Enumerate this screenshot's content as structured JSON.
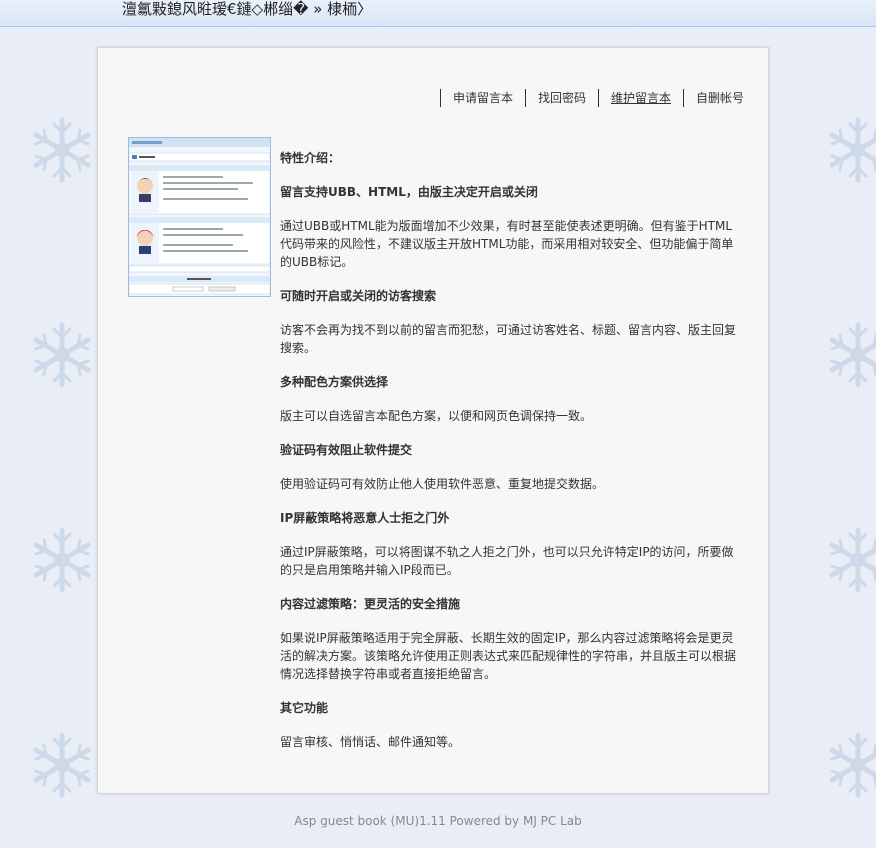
{
  "topbar": {
    "breadcrumb": "澶氱敤鎴风暀瑷€鏈◇郴缁� » 棣栭〉"
  },
  "nav": {
    "items": [
      {
        "label": "申请留言本",
        "active": false
      },
      {
        "label": "找回密码",
        "active": false
      },
      {
        "label": "维护留言本",
        "active": true
      },
      {
        "label": "自删帐号",
        "active": false
      }
    ]
  },
  "main": {
    "heading": "特性介绍：",
    "sections": [
      {
        "title": "留言支持UBB、HTML，由版主决定开启或关闭",
        "body": "通过UBB或HTML能为版面增加不少效果，有时甚至能使表述更明确。但有鉴于HTML代码带来的风险性，不建议版主开放HTML功能，而采用相对较安全、但功能偏于简单的UBB标记。"
      },
      {
        "title": "可随时开启或关闭的访客搜索",
        "body": "访客不会再为找不到以前的留言而犯愁，可通过访客姓名、标题、留言内容、版主回复搜索。"
      },
      {
        "title": "多种配色方案供选择",
        "body": "版主可以自选留言本配色方案，以便和网页色调保持一致。"
      },
      {
        "title": "验证码有效阻止软件提交",
        "body": "使用验证码可有效防止他人使用软件恶意、重复地提交数据。"
      },
      {
        "title": "IP屏蔽策略将恶意人士拒之门外",
        "body": "通过IP屏蔽策略，可以将图谋不轨之人拒之门外，也可以只允许特定IP的访问，所要做的只是启用策略并输入IP段而已。"
      },
      {
        "title": "内容过滤策略：更灵活的安全措施",
        "body": "如果说IP屏蔽策略适用于完全屏蔽、长期生效的固定IP，那么内容过滤策略将会是更灵活的解决方案。该策略允许使用正则表达式来匹配规律性的字符串，并且版主可以根据情况选择替换字符串或者直接拒绝留言。"
      },
      {
        "title": "其它功能",
        "body": "留言审核、悄悄话、邮件通知等。"
      }
    ]
  },
  "footer": {
    "text": "Asp guest book (MU)1.11 Powered by MJ PC Lab"
  },
  "colors": {
    "page_background": "#e9eef6",
    "panel_background": "#f7f7f7",
    "snowflake": "#cdd8e8",
    "topbar_border": "#a9c3e6",
    "thumbnail_border": "#9ebde0"
  }
}
